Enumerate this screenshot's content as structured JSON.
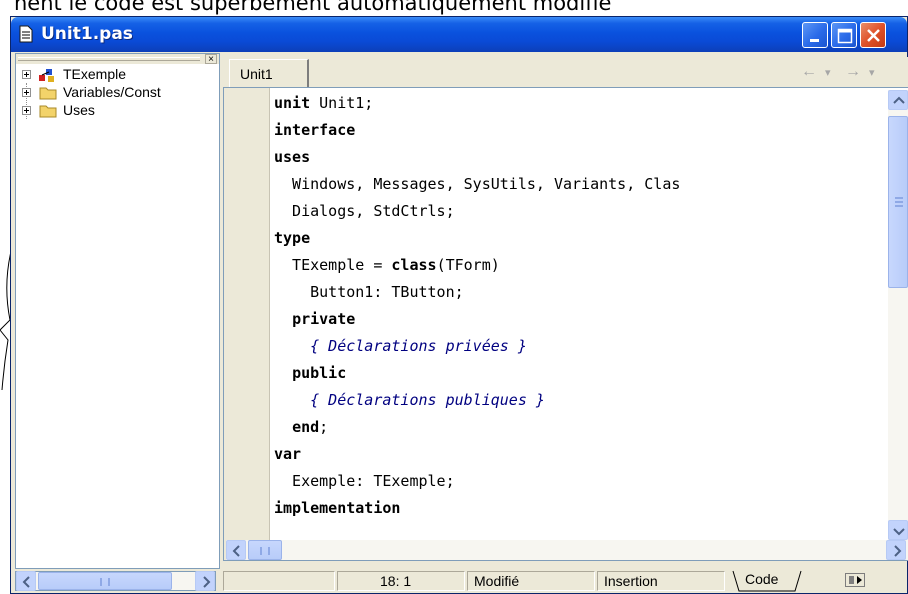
{
  "document": {
    "top_text": "nent le code est superbement automatiquement modifié"
  },
  "window": {
    "title": "Unit1.pas",
    "controls": {
      "minimize": "minimize",
      "maximize": "maximize",
      "close": "close"
    }
  },
  "explorer": {
    "close_glyph": "×",
    "items": [
      {
        "label": "TExemple",
        "icon": "class-icon"
      },
      {
        "label": "Variables/Const",
        "icon": "folder-icon"
      },
      {
        "label": "Uses",
        "icon": "folder-icon"
      }
    ]
  },
  "editor": {
    "tab_label": "Unit1",
    "nav": {
      "back": "←",
      "back_drop": "▾",
      "forward": "→",
      "forward_drop": "▾"
    },
    "lines": [
      {
        "kw": "unit",
        "rest": " Unit1;"
      },
      {
        "kw": "interface",
        "rest": ""
      },
      {
        "kw": "uses",
        "rest": ""
      },
      {
        "text": "  Windows, Messages, SysUtils, Variants, Clas"
      },
      {
        "text": "  Dialogs, StdCtrls;"
      },
      {
        "kw": "type",
        "rest": ""
      },
      {
        "pre": "  TExemple = ",
        "kw": "class",
        "rest": "(TForm)"
      },
      {
        "text": "    Button1: TButton;"
      },
      {
        "pre": "  ",
        "kw": "private",
        "rest": ""
      },
      {
        "comment": "    { Déclarations privées }"
      },
      {
        "pre": "  ",
        "kw": "public",
        "rest": ""
      },
      {
        "comment": "    { Déclarations publiques }"
      },
      {
        "pre": "  ",
        "kw": "end",
        "rest": ";"
      },
      {
        "kw": "var",
        "rest": ""
      },
      {
        "text": "  Exemple: TExemple;"
      },
      {
        "kw": "implementation",
        "rest": ""
      }
    ]
  },
  "status": {
    "position": "18:  1",
    "modified": "Modifié",
    "mode": "Insertion",
    "view_tab": "Code"
  },
  "colors": {
    "titlebar": "#0a52de",
    "comment": "#000080",
    "chrome": "#ece9d8"
  }
}
